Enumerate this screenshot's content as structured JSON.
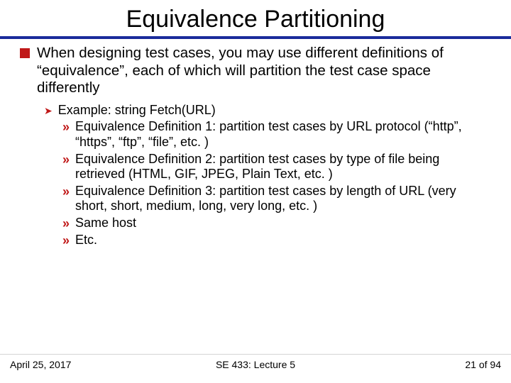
{
  "title": "Equivalence Partitioning",
  "bullet1": "When designing test cases, you may use different definitions of “equivalence”, each of which will partition the test case space differently",
  "example_label": "Example: string Fetch(URL)",
  "def1": "Equivalence Definition 1: partition test cases by URL protocol (“http”, “https”, “ftp”, “file”, etc. )",
  "def2": "Equivalence Definition 2: partition test cases by type of file being retrieved (HTML, GIF, JPEG, Plain Text, etc. )",
  "def3": "Equivalence Definition 3: partition test cases by length of URL (very short, short, medium, long, very long, etc. )",
  "def4": "Same host",
  "def5": "Etc.",
  "footer": {
    "date": "April 25, 2017",
    "course": "SE 433: Lecture 5",
    "page": "21 of 94"
  }
}
